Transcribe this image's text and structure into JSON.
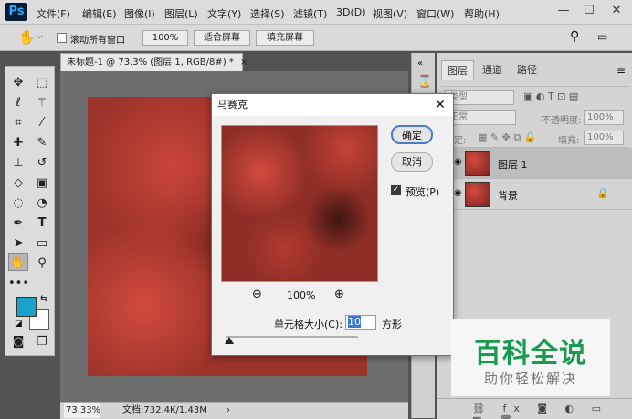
{
  "app": {
    "logo": "Ps"
  },
  "menu": [
    "文件(F)",
    "编辑(E)",
    "图像(I)",
    "图层(L)",
    "文字(Y)",
    "选择(S)",
    "滤镜(T)",
    "3D(D)",
    "视图(V)",
    "窗口(W)",
    "帮助(H)"
  ],
  "window_controls": {
    "minimize": "—",
    "maximize": "☐",
    "close": "✕"
  },
  "options_bar": {
    "hand_icon": "hand-icon",
    "scroll_all": "滚动所有窗口",
    "zoom_100": "100%",
    "fit_screen": "适合屏幕",
    "fill_screen": "填充屏幕"
  },
  "document": {
    "tab_title": "未标题-1 @ 73.3% (图层 1, RGB/8#) *",
    "tab_close": "×",
    "zoom": "73.33%",
    "doc_info": "文档:732.4K/1.43M",
    "arrow": "›"
  },
  "panels": {
    "tabs": [
      "图层",
      "通道",
      "路径"
    ],
    "kind": "类型",
    "blend": "正常",
    "opacity_label": "不透明度:",
    "opacity": "100%",
    "lock_label": "锁定:",
    "fill_label": "填充:",
    "fill": "100%"
  },
  "layers": [
    {
      "name": "图层 1",
      "selected": true
    },
    {
      "name": "背景",
      "locked": true
    }
  ],
  "dialog": {
    "title": "马赛克",
    "close": "✕",
    "ok": "确定",
    "cancel": "取消",
    "preview_label": "预览(P)",
    "preview_checked": true,
    "zoom_out": "⊖",
    "zoom": "100%",
    "zoom_in": "⊕",
    "cell_label": "单元格大小(C):",
    "cell_value": "10",
    "cell_unit": "方形",
    "cell_size_fraction": 0.02
  },
  "watermark": {
    "title": "百科全说",
    "subtitle": "助你轻松解决"
  },
  "colors": {
    "foreground": "#19a3c9",
    "background": "#ffffff",
    "wm_green": "#1a9a50"
  }
}
